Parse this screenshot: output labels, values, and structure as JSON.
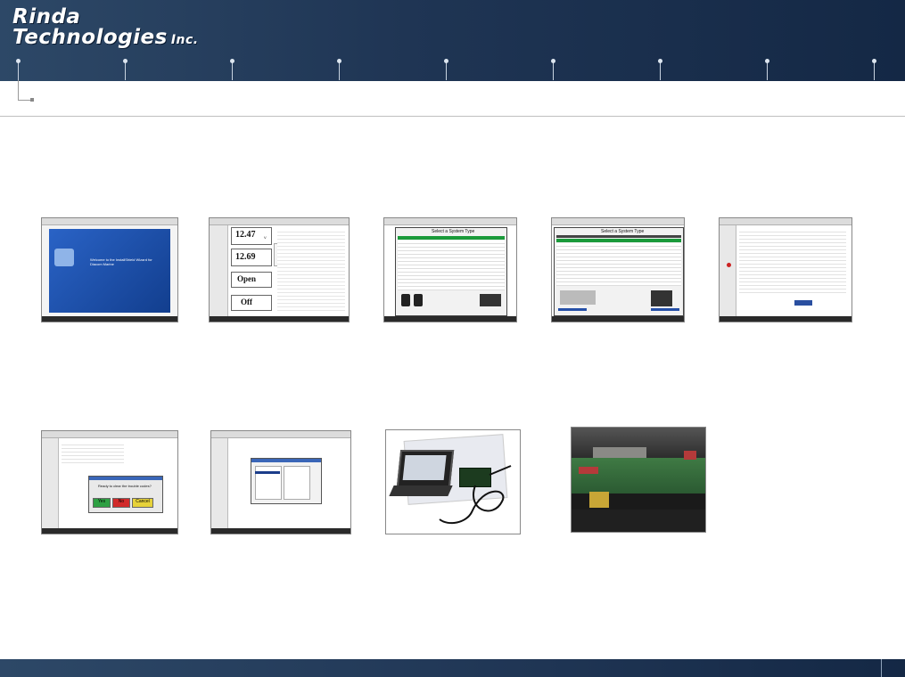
{
  "brand": {
    "line1": "Rinda",
    "line2": "Technologies",
    "suffix": "Inc."
  },
  "thumbnails": [
    {
      "id": "install-wizard",
      "caption": "Welcome to the InstallShield Wizard for Diacom Marine"
    },
    {
      "id": "gauges",
      "gauge1_value": "12.47",
      "gauge1_unit": "V",
      "gauge2_value": "12.69",
      "switch_value": "Open",
      "status_value": "Off"
    },
    {
      "id": "system-type-1",
      "title": "Select a System Type"
    },
    {
      "id": "system-type-2",
      "title": "Select a System Type"
    },
    {
      "id": "data-list"
    },
    {
      "id": "dialog",
      "prompt": "Ready to clear the trouble codes?",
      "yes": "Yes",
      "no": "No",
      "cancel": "Cancel"
    },
    {
      "id": "small-window"
    },
    {
      "id": "laptop-cable"
    },
    {
      "id": "circuit-board"
    }
  ],
  "colors": {
    "header": "#1f3554",
    "green": "#2ea043",
    "red": "#d12a2a",
    "yellow": "#e6d23a"
  }
}
